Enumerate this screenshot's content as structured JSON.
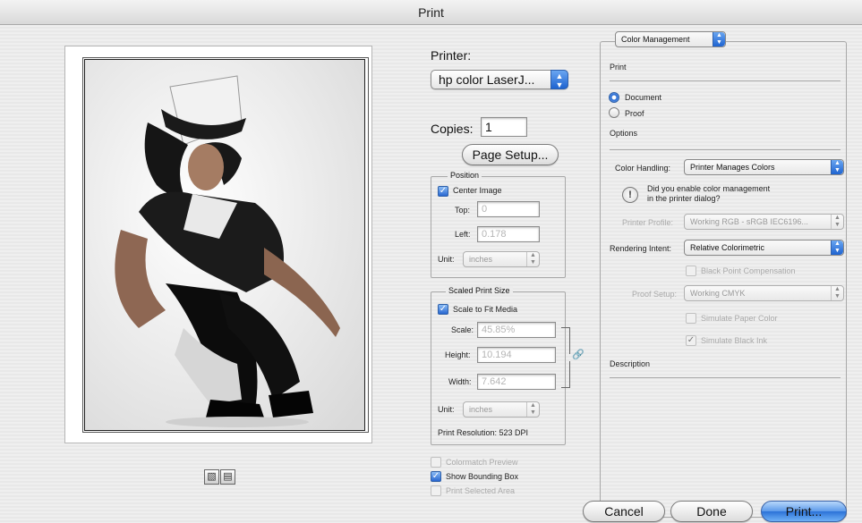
{
  "window": {
    "title": "Print"
  },
  "printer": {
    "label": "Printer:",
    "value": "hp color LaserJ..."
  },
  "copies": {
    "label": "Copies:",
    "value": "1"
  },
  "page_setup_label": "Page Setup...",
  "position": {
    "title": "Position",
    "center_image": {
      "label": "Center Image",
      "checked": true
    },
    "top": {
      "label": "Top:",
      "value": "0"
    },
    "left": {
      "label": "Left:",
      "value": "0.178"
    },
    "unit": {
      "label": "Unit:",
      "value": "inches"
    }
  },
  "scaled": {
    "title": "Scaled Print Size",
    "scale_to_fit": {
      "label": "Scale to Fit Media",
      "checked": true
    },
    "scale": {
      "label": "Scale:",
      "value": "45.85%"
    },
    "height": {
      "label": "Height:",
      "value": "10.194"
    },
    "width": {
      "label": "Width:",
      "value": "7.642"
    },
    "unit": {
      "label": "Unit:",
      "value": "inches"
    },
    "resolution": "Print Resolution: 523 DPI"
  },
  "options": {
    "colormatch_preview": {
      "label": "Colormatch Preview",
      "checked": false
    },
    "show_bounding_box": {
      "label": "Show Bounding Box",
      "checked": true
    },
    "print_selected_area": {
      "label": "Print Selected Area",
      "checked": false
    }
  },
  "color_mgmt": {
    "section_popup": "Color Management",
    "print_heading": "Print",
    "document_label": "Document",
    "proof_label": "Proof",
    "options_heading": "Options",
    "color_handling": {
      "label": "Color Handling:",
      "value": "Printer Manages Colors"
    },
    "info_line1": "Did you enable color management",
    "info_line2": "in the printer dialog?",
    "printer_profile": {
      "label": "Printer Profile:",
      "value": "Working RGB - sRGB IEC6196..."
    },
    "rendering_intent": {
      "label": "Rendering Intent:",
      "value": "Relative Colorimetric"
    },
    "black_point": {
      "label": "Black Point Compensation",
      "checked": false
    },
    "proof_setup": {
      "label": "Proof Setup:",
      "value": "Working CMYK"
    },
    "simulate_paper": {
      "label": "Simulate Paper Color",
      "checked": false
    },
    "simulate_ink": {
      "label": "Simulate Black Ink",
      "checked": true
    },
    "description_heading": "Description"
  },
  "buttons": {
    "cancel": "Cancel",
    "done": "Done",
    "print": "Print..."
  },
  "icons": {
    "portrait": "portrait-orientation-icon",
    "landscape": "landscape-orientation-icon",
    "link": "link-chain-icon",
    "info": "info-icon",
    "check": "✓"
  }
}
